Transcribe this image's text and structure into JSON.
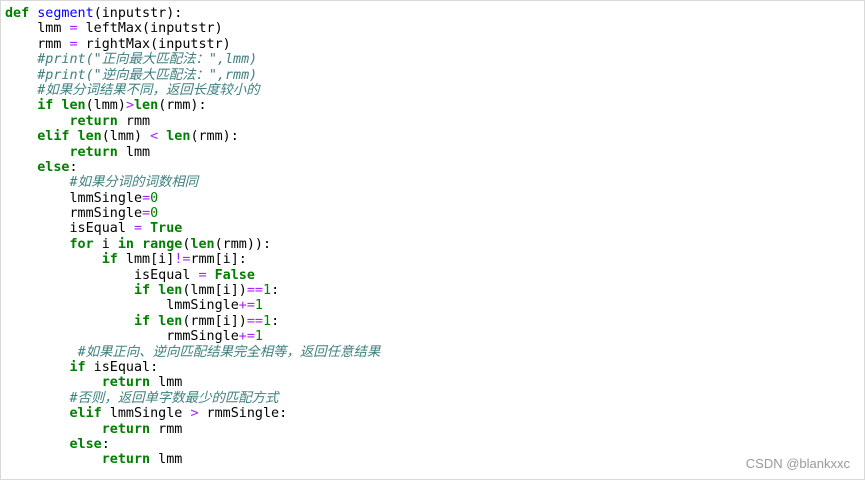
{
  "code": {
    "lines": [
      [
        {
          "t": "kw",
          "v": "def"
        },
        {
          "t": "p",
          "v": " "
        },
        {
          "t": "fn",
          "v": "segment"
        },
        {
          "t": "p",
          "v": "(inputstr):"
        }
      ],
      [
        {
          "t": "p",
          "v": "    lmm "
        },
        {
          "t": "op",
          "v": "="
        },
        {
          "t": "p",
          "v": " leftMax(inputstr)"
        }
      ],
      [
        {
          "t": "p",
          "v": "    rmm "
        },
        {
          "t": "op",
          "v": "="
        },
        {
          "t": "p",
          "v": " rightMax(inputstr)"
        }
      ],
      [
        {
          "t": "p",
          "v": "    "
        },
        {
          "t": "cm",
          "v": "#print(\"正向最大匹配法：\",lmm)"
        }
      ],
      [
        {
          "t": "p",
          "v": "    "
        },
        {
          "t": "cm",
          "v": "#print(\"逆向最大匹配法：\",rmm)"
        }
      ],
      [
        {
          "t": "p",
          "v": "    "
        },
        {
          "t": "cm",
          "v": "#如果分词结果不同，返回长度较小的"
        }
      ],
      [
        {
          "t": "p",
          "v": "    "
        },
        {
          "t": "kw",
          "v": "if"
        },
        {
          "t": "p",
          "v": " "
        },
        {
          "t": "kw",
          "v": "len"
        },
        {
          "t": "p",
          "v": "(lmm)"
        },
        {
          "t": "op",
          "v": ">"
        },
        {
          "t": "kw",
          "v": "len"
        },
        {
          "t": "p",
          "v": "(rmm):"
        }
      ],
      [
        {
          "t": "p",
          "v": "        "
        },
        {
          "t": "kw",
          "v": "return"
        },
        {
          "t": "p",
          "v": " rmm"
        }
      ],
      [
        {
          "t": "p",
          "v": "    "
        },
        {
          "t": "kw",
          "v": "elif"
        },
        {
          "t": "p",
          "v": " "
        },
        {
          "t": "kw",
          "v": "len"
        },
        {
          "t": "p",
          "v": "(lmm) "
        },
        {
          "t": "op",
          "v": "<"
        },
        {
          "t": "p",
          "v": " "
        },
        {
          "t": "kw",
          "v": "len"
        },
        {
          "t": "p",
          "v": "(rmm):"
        }
      ],
      [
        {
          "t": "p",
          "v": "        "
        },
        {
          "t": "kw",
          "v": "return"
        },
        {
          "t": "p",
          "v": " lmm"
        }
      ],
      [
        {
          "t": "p",
          "v": "    "
        },
        {
          "t": "kw",
          "v": "else"
        },
        {
          "t": "p",
          "v": ":"
        }
      ],
      [
        {
          "t": "p",
          "v": "        "
        },
        {
          "t": "cm",
          "v": "#如果分词的词数相同"
        }
      ],
      [
        {
          "t": "p",
          "v": "        lmmSingle"
        },
        {
          "t": "op",
          "v": "="
        },
        {
          "t": "num",
          "v": "0"
        }
      ],
      [
        {
          "t": "p",
          "v": "        rmmSingle"
        },
        {
          "t": "op",
          "v": "="
        },
        {
          "t": "num",
          "v": "0"
        }
      ],
      [
        {
          "t": "p",
          "v": "        isEqual "
        },
        {
          "t": "op",
          "v": "="
        },
        {
          "t": "p",
          "v": " "
        },
        {
          "t": "kw",
          "v": "True"
        }
      ],
      [
        {
          "t": "p",
          "v": "        "
        },
        {
          "t": "kw",
          "v": "for"
        },
        {
          "t": "p",
          "v": " i "
        },
        {
          "t": "kw",
          "v": "in"
        },
        {
          "t": "p",
          "v": " "
        },
        {
          "t": "kw",
          "v": "range"
        },
        {
          "t": "p",
          "v": "("
        },
        {
          "t": "kw",
          "v": "len"
        },
        {
          "t": "p",
          "v": "(rmm)):"
        }
      ],
      [
        {
          "t": "p",
          "v": "            "
        },
        {
          "t": "kw",
          "v": "if"
        },
        {
          "t": "p",
          "v": " lmm[i]"
        },
        {
          "t": "op",
          "v": "!="
        },
        {
          "t": "p",
          "v": "rmm[i]:"
        }
      ],
      [
        {
          "t": "p",
          "v": "                isEqual "
        },
        {
          "t": "op",
          "v": "="
        },
        {
          "t": "p",
          "v": " "
        },
        {
          "t": "kw",
          "v": "False"
        }
      ],
      [
        {
          "t": "p",
          "v": "                "
        },
        {
          "t": "kw",
          "v": "if"
        },
        {
          "t": "p",
          "v": " "
        },
        {
          "t": "kw",
          "v": "len"
        },
        {
          "t": "p",
          "v": "(lmm[i])"
        },
        {
          "t": "op",
          "v": "=="
        },
        {
          "t": "num",
          "v": "1"
        },
        {
          "t": "p",
          "v": ":"
        }
      ],
      [
        {
          "t": "p",
          "v": "                    lmmSingle"
        },
        {
          "t": "op",
          "v": "+="
        },
        {
          "t": "num",
          "v": "1"
        }
      ],
      [
        {
          "t": "p",
          "v": "                "
        },
        {
          "t": "kw",
          "v": "if"
        },
        {
          "t": "p",
          "v": " "
        },
        {
          "t": "kw",
          "v": "len"
        },
        {
          "t": "p",
          "v": "(rmm[i])"
        },
        {
          "t": "op",
          "v": "=="
        },
        {
          "t": "num",
          "v": "1"
        },
        {
          "t": "p",
          "v": ":"
        }
      ],
      [
        {
          "t": "p",
          "v": "                    rmmSingle"
        },
        {
          "t": "op",
          "v": "+="
        },
        {
          "t": "num",
          "v": "1"
        }
      ],
      [
        {
          "t": "p",
          "v": "         "
        },
        {
          "t": "cm",
          "v": "#如果正向、逆向匹配结果完全相等，返回任意结果"
        }
      ],
      [
        {
          "t": "p",
          "v": "        "
        },
        {
          "t": "kw",
          "v": "if"
        },
        {
          "t": "p",
          "v": " isEqual:"
        }
      ],
      [
        {
          "t": "p",
          "v": "            "
        },
        {
          "t": "kw",
          "v": "return"
        },
        {
          "t": "p",
          "v": " lmm"
        }
      ],
      [
        {
          "t": "p",
          "v": "        "
        },
        {
          "t": "cm",
          "v": "#否则，返回单字数最少的匹配方式"
        }
      ],
      [
        {
          "t": "p",
          "v": "        "
        },
        {
          "t": "kw",
          "v": "elif"
        },
        {
          "t": "p",
          "v": " lmmSingle "
        },
        {
          "t": "op",
          "v": ">"
        },
        {
          "t": "p",
          "v": " rmmSingle:"
        }
      ],
      [
        {
          "t": "p",
          "v": "            "
        },
        {
          "t": "kw",
          "v": "return"
        },
        {
          "t": "p",
          "v": " rmm"
        }
      ],
      [
        {
          "t": "p",
          "v": "        "
        },
        {
          "t": "kw",
          "v": "else"
        },
        {
          "t": "p",
          "v": ":"
        }
      ],
      [
        {
          "t": "p",
          "v": "            "
        },
        {
          "t": "kw",
          "v": "return"
        },
        {
          "t": "p",
          "v": " lmm"
        }
      ]
    ]
  },
  "watermark": {
    "text": "CSDN @blankxxc"
  },
  "colors": {
    "keyword": "#008000",
    "function_name": "#0000ff",
    "operator": "#aa22ff",
    "number": "#008000",
    "comment": "#408080",
    "watermark": "#9a9a9a"
  }
}
